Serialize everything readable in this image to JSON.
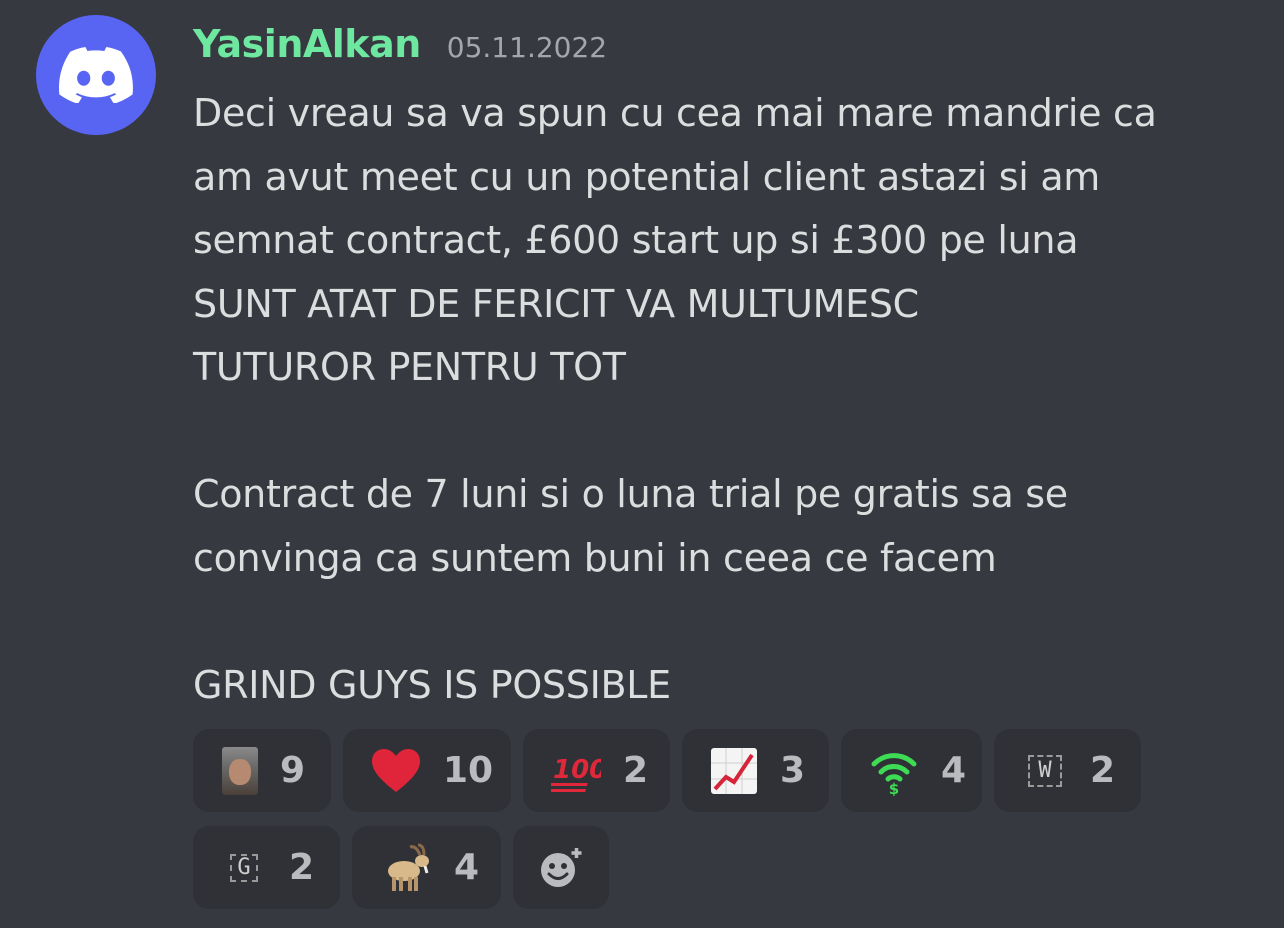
{
  "message": {
    "username": "YasinAlkan",
    "timestamp": "05.11.2022",
    "lines": [
      "Deci vreau sa va spun cu cea mai mare mandrie ca",
      "am avut meet cu un potential client astazi si am",
      "semnat contract, £600 start up si £300 pe luna",
      "SUNT ATAT DE FERICIT VA MULTUMESC",
      "TUTUROR PENTRU TOT",
      "",
      "Contract de 7 luni si o luna trial pe gratis sa se",
      "convinga ca suntem buni in ceea ce facem",
      "",
      "GRIND GUYS IS POSSIBLE"
    ]
  },
  "reactions": [
    {
      "icon": "custom-face-emoji",
      "count": "9"
    },
    {
      "icon": "red-heart-emoji",
      "count": "10"
    },
    {
      "icon": "hundred-points-emoji",
      "count": "2"
    },
    {
      "icon": "chart-increasing-emoji",
      "count": "3"
    },
    {
      "icon": "wifi-money-emoji",
      "count": "4"
    },
    {
      "icon": "custom-w-emoji",
      "count": "2"
    },
    {
      "icon": "custom-g-emoji",
      "count": "2"
    },
    {
      "icon": "goat-emoji",
      "count": "4"
    }
  ],
  "colors": {
    "background": "#36393f",
    "username": "#6ee7a0",
    "avatar": "#5865f2",
    "reaction_bg": "#2f3136",
    "text": "#dcddde"
  }
}
